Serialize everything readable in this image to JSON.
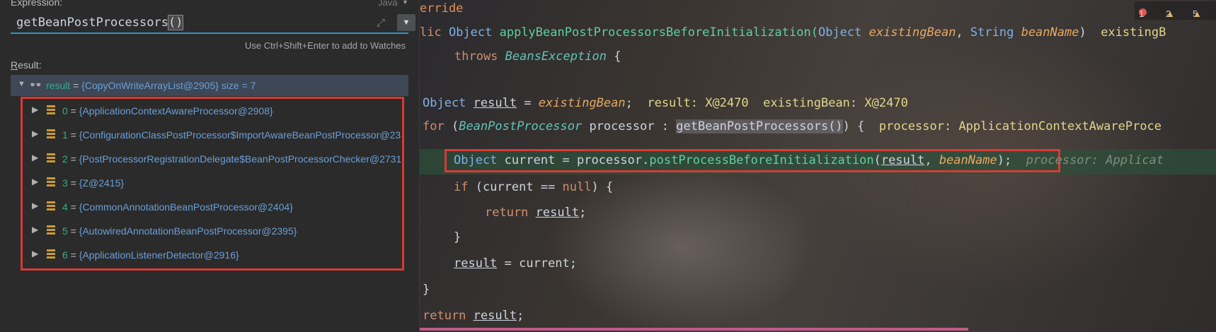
{
  "evaluate": {
    "expression_label": "Expression:",
    "language": "Java",
    "expression": "getBeanPostProcessors",
    "expression_parens": "()",
    "hint": "Use Ctrl+Shift+Enter to add to Watches",
    "result_label_first": "R",
    "result_label_rest": "esult:",
    "result": {
      "name": "result",
      "eq": " = ",
      "value": "{CopyOnWriteArrayList@2905}  size = 7"
    },
    "children": [
      {
        "index": "0",
        "value": "{ApplicationContextAwareProcessor@2908}"
      },
      {
        "index": "1",
        "value": "{ConfigurationClassPostProcessor$ImportAwareBeanPostProcessor@23"
      },
      {
        "index": "2",
        "value": "{PostProcessorRegistrationDelegate$BeanPostProcessorChecker@2731"
      },
      {
        "index": "3",
        "value": "{Z@2415}"
      },
      {
        "index": "4",
        "value": "{CommonAnnotationBeanPostProcessor@2404}"
      },
      {
        "index": "5",
        "value": "{AutowiredAnnotationBeanPostProcessor@2395}"
      },
      {
        "index": "6",
        "value": "{ApplicationListenerDetector@2916}"
      }
    ]
  },
  "editor": {
    "status": {
      "errors": "1",
      "warnings": "2",
      "weak": "5"
    },
    "l1": {
      "a": "erride"
    },
    "l2": {
      "a": "lic ",
      "b": "Object ",
      "c": "applyBeanPostProcessorsBeforeInitialization(",
      "d": "Object ",
      "e": "existingBean",
      "f": ", ",
      "g": "String ",
      "h": "beanName",
      "i": ")  ",
      "j": "existingB"
    },
    "l3": {
      "a": "throws ",
      "b": "BeansException",
      "c": " {"
    },
    "l4": {
      "a": "Object ",
      "b": "result",
      "c": " = ",
      "d": "existingBean",
      "e": ";  ",
      "f": "result: X@2470  existingBean: X@2470"
    },
    "l5": {
      "a": "for ",
      "b": "(",
      "c": "BeanPostProcessor",
      "d": " processor : ",
      "e": "getBeanPostProcessors()",
      "f": ") {  ",
      "g": "processor: ApplicationContextAwareProce"
    },
    "l6": {
      "a": "Object ",
      "b": "current",
      "c": " = processor.",
      "d": "postProcessBeforeInitialization",
      "e": "(",
      "f": "result",
      "g": ", ",
      "h": "beanName",
      "i": ");",
      "j": "  processor: Applicat"
    },
    "l7": {
      "a": "if ",
      "b": "(current == ",
      "c": "null",
      "d": ") {"
    },
    "l8": {
      "a": "return ",
      "b": "result",
      "c": ";"
    },
    "l9": {
      "a": "}"
    },
    "l10": {
      "a": "result",
      "b": " = current;"
    },
    "l11": {
      "a": "}"
    },
    "l12": {
      "a": "return ",
      "b": "result",
      "c": ";"
    }
  }
}
